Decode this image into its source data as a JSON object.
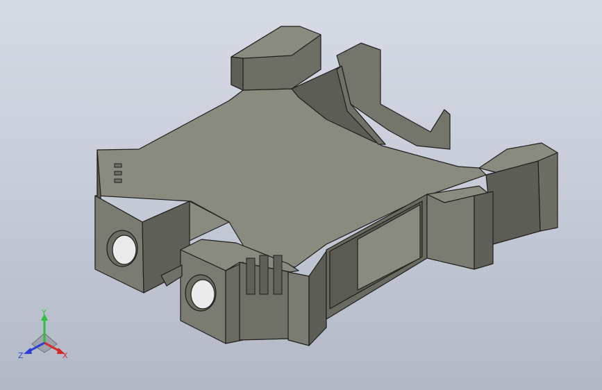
{
  "viewport": {
    "background_top": "#d7dbe6",
    "background_bottom": "#b3b8c6"
  },
  "model": {
    "part_color": "#7f8074",
    "top_face_color": "#8a8b7f",
    "side_face_color": "#6b6c62",
    "dark_face_color": "#55564d",
    "edge_color": "#1e1e1c"
  },
  "triad": {
    "x_label": "X",
    "y_label": "Y",
    "z_label": "Z",
    "x_color": "#d42a2a",
    "y_color": "#2fbf3a",
    "z_color": "#2a3fd4"
  }
}
